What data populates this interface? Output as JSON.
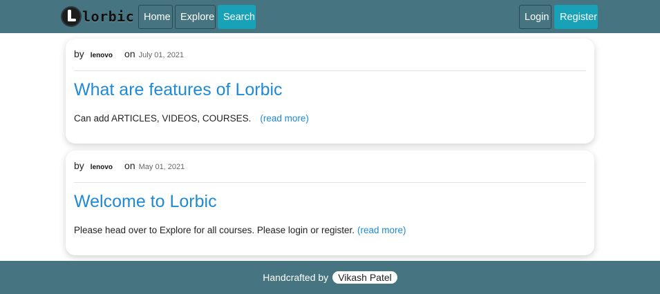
{
  "navbar": {
    "logo_text": "lorbic",
    "logo_icon": "lorbic-logo-icon",
    "home_label": "Home",
    "explore_label": "Explore",
    "search_label": "Search",
    "login_label": "Login",
    "register_label": "Register",
    "colors": {
      "bar": "#467480",
      "active": "#17a2b8"
    }
  },
  "posts": [
    {
      "by_label": "by",
      "author": "lenovo",
      "on_label": "on",
      "date": "July 01, 2021",
      "title": "What are features of Lorbic",
      "excerpt": "Can add ARTICLES, VIDEOS, COURSES.",
      "read_more": "(read more)"
    },
    {
      "by_label": "by",
      "author": "lenovo",
      "on_label": "on",
      "date": "May 01, 2021",
      "title": "Welcome to Lorbic",
      "excerpt": "Please head over to Explore for all courses. Please login or register.",
      "read_more": "(read more)"
    }
  ],
  "footer": {
    "text": "Handcrafted by",
    "author": "Vikash Patel"
  },
  "colors": {
    "link": "#1e8ad6"
  }
}
